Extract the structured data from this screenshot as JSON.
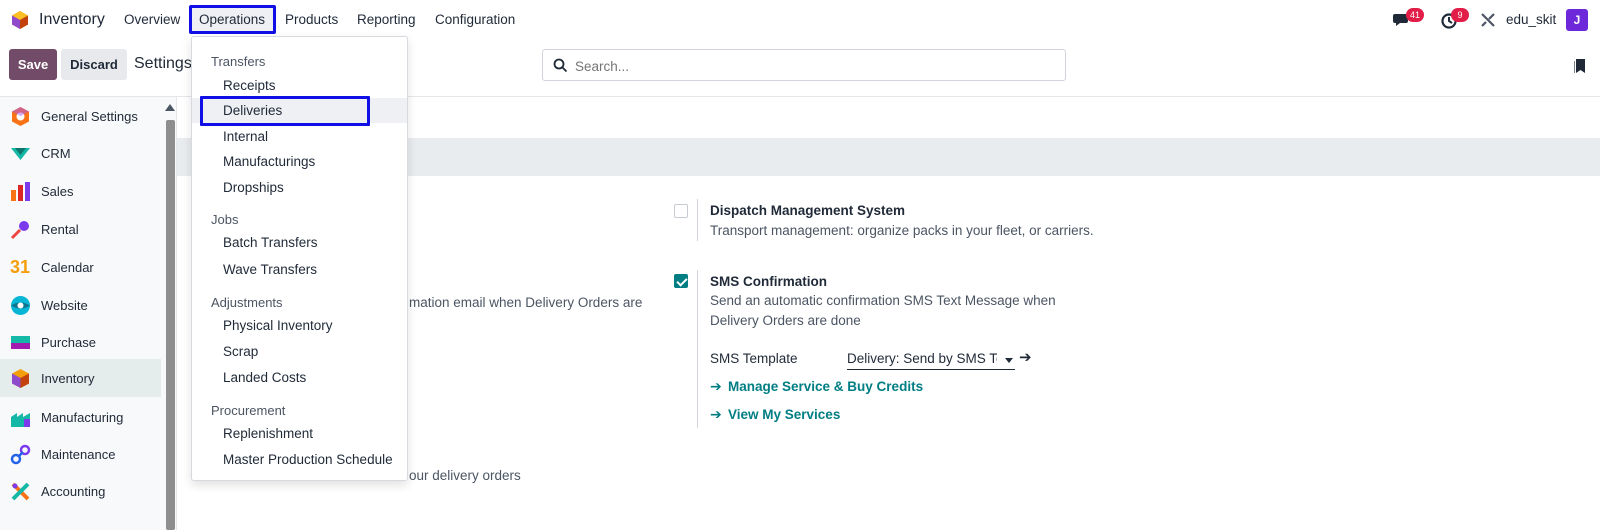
{
  "app": {
    "name": "Inventory",
    "brand_color": "#714b67",
    "accent_color": "#017e84",
    "highlight_color": "#1010e6"
  },
  "topnav": {
    "items": [
      "Overview",
      "Operations",
      "Products",
      "Reporting",
      "Configuration"
    ],
    "active": "Operations",
    "messages_count": "41",
    "activities_count": "9",
    "username": "edu_skit",
    "avatar_letter": "J"
  },
  "controls": {
    "save_label": "Save",
    "discard_label": "Discard",
    "breadcrumb": "Settings",
    "search_placeholder": "Search..."
  },
  "sidebar": {
    "items": [
      {
        "label": "General Settings",
        "icon": "general-settings-icon"
      },
      {
        "label": "CRM",
        "icon": "crm-icon"
      },
      {
        "label": "Sales",
        "icon": "sales-icon"
      },
      {
        "label": "Rental",
        "icon": "rental-icon"
      },
      {
        "label": "Calendar",
        "icon": "calendar-icon"
      },
      {
        "label": "Website",
        "icon": "website-icon"
      },
      {
        "label": "Purchase",
        "icon": "purchase-icon"
      },
      {
        "label": "Inventory",
        "icon": "inventory-icon"
      },
      {
        "label": "Manufacturing",
        "icon": "manufacturing-icon"
      },
      {
        "label": "Maintenance",
        "icon": "maintenance-icon"
      },
      {
        "label": "Accounting",
        "icon": "accounting-icon"
      }
    ],
    "active": "Inventory",
    "calendar_number": "31"
  },
  "content": {
    "partial_email_text": "mation email when Delivery Orders are",
    "partial_delivery_text": "our delivery orders",
    "dispatch": {
      "title": "Dispatch Management System",
      "description": "Transport management: organize packs in your fleet, or carriers.",
      "checked": false
    },
    "sms": {
      "title": "SMS Confirmation",
      "description_line1": "Send an automatic confirmation SMS Text Message when",
      "description_line2": "Delivery Orders are done",
      "checked": true,
      "template_label": "SMS Template",
      "template_value": "Delivery: Send by SMS Text Message",
      "link_manage": "Manage Service & Buy Credits",
      "link_view": "View My Services"
    }
  },
  "dropdown": {
    "sections": [
      {
        "header": "Transfers",
        "items": [
          "Receipts",
          "Deliveries",
          "Internal",
          "Manufacturings",
          "Dropships"
        ]
      },
      {
        "header": "Jobs",
        "items": [
          "Batch Transfers",
          "Wave Transfers"
        ]
      },
      {
        "header": "Adjustments",
        "items": [
          "Physical Inventory",
          "Scrap",
          "Landed Costs"
        ]
      },
      {
        "header": "Procurement",
        "items": [
          "Replenishment",
          "Master Production Schedule"
        ]
      }
    ],
    "hovered": "Deliveries"
  }
}
